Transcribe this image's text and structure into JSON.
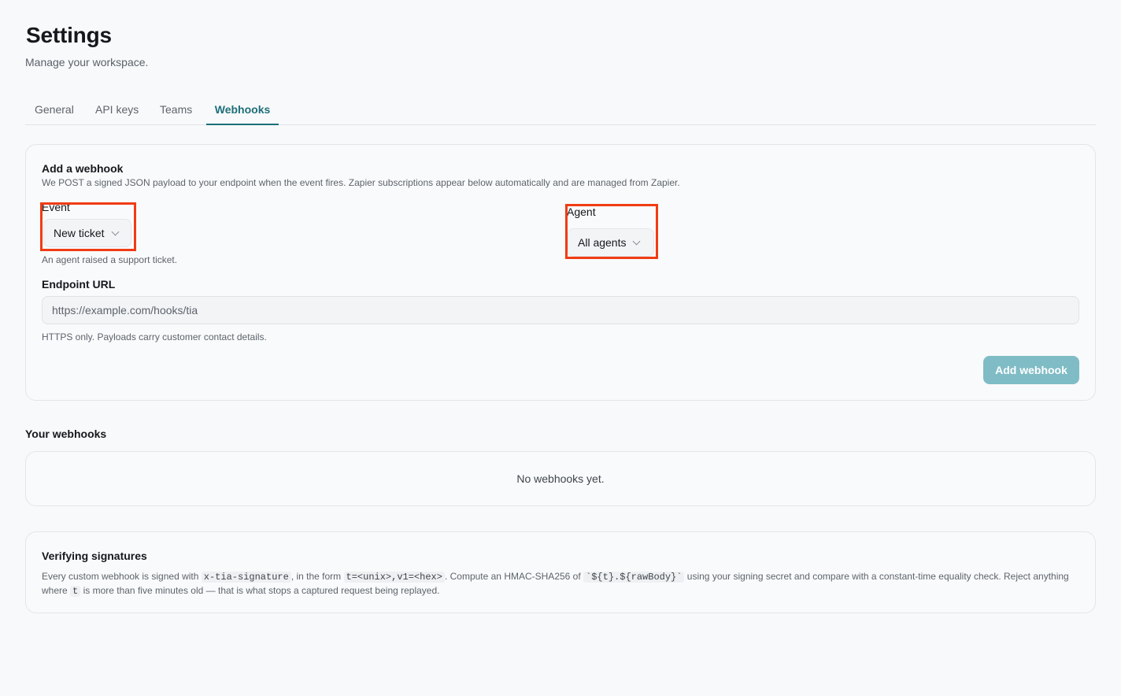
{
  "header": {
    "title": "Settings",
    "subtitle": "Manage your workspace."
  },
  "tabs": [
    {
      "label": "General",
      "active": false
    },
    {
      "label": "API keys",
      "active": false
    },
    {
      "label": "Teams",
      "active": false
    },
    {
      "label": "Webhooks",
      "active": true
    }
  ],
  "add_webhook": {
    "title": "Add a webhook",
    "description": "We POST a signed JSON payload to your endpoint when the event fires. Zapier subscriptions appear below automatically and are managed from Zapier.",
    "event": {
      "label": "Event",
      "value": "New ticket",
      "help": "An agent raised a support ticket."
    },
    "agent": {
      "label": "Agent",
      "value": "All agents"
    },
    "endpoint": {
      "label": "Endpoint URL",
      "placeholder": "https://example.com/hooks/tia",
      "help": "HTTPS only. Payloads carry customer contact details."
    },
    "submit_label": "Add webhook"
  },
  "webhooks_list": {
    "title": "Your webhooks",
    "empty_text": "No webhooks yet."
  },
  "verifying": {
    "title": "Verifying signatures",
    "t1": "Every custom webhook is signed with",
    "code1": "x-tia-signature",
    "t2": ", in the form",
    "code2": "t=<unix>,v1=<hex>",
    "t3": ". Compute an HMAC-SHA256 of",
    "code3": "`${t}.${rawBody}`",
    "t4": "using your signing secret and compare with a constant-time equality check. Reject anything where",
    "code4": "t",
    "t5": "is more than five minutes old — that is what stops a captured request being replayed."
  },
  "colors": {
    "accent": "#1d6f7a",
    "button_disabled": "#7fbcc6",
    "highlight": "#f03c14",
    "background": "#f8f9fa"
  }
}
